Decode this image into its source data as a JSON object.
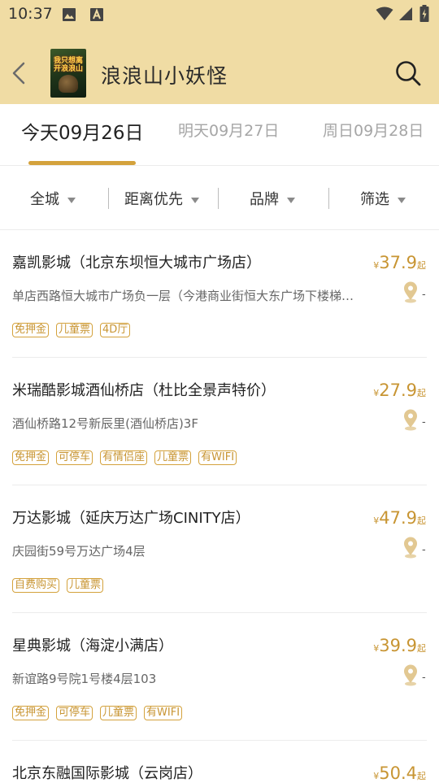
{
  "status_bar": {
    "time": "10:37"
  },
  "header": {
    "movie_title": "浪浪山小妖怪",
    "poster_text": "我只想离开浪浪山"
  },
  "date_tabs": [
    {
      "label": "今天09月26日",
      "active": true
    },
    {
      "label": "明天09月27日",
      "active": false
    },
    {
      "label": "周日09月28日",
      "active": false
    }
  ],
  "filters": [
    {
      "label": "全城"
    },
    {
      "label": "距离优先"
    },
    {
      "label": "品牌"
    },
    {
      "label": "筛选"
    }
  ],
  "cinemas": [
    {
      "name": "嘉凯影城（北京东坝恒大城市广场店）",
      "price_symbol": "¥",
      "price": "37.9",
      "price_suffix": "起",
      "address": "单店西路恒大城市广场负一层（今港商业街恒大东广场下楼梯…",
      "distance": "-",
      "tags": [
        "免押金",
        "儿童票",
        "4D厅"
      ]
    },
    {
      "name": "米瑞酷影城酒仙桥店（杜比全景声特价）",
      "price_symbol": "¥",
      "price": "27.9",
      "price_suffix": "起",
      "address": "酒仙桥路12号新辰里(酒仙桥店)3F",
      "distance": "-",
      "tags": [
        "免押金",
        "可停车",
        "有情侣座",
        "儿童票",
        "有WIFI"
      ]
    },
    {
      "name": "万达影城（延庆万达广场CINITY店）",
      "price_symbol": "¥",
      "price": "47.9",
      "price_suffix": "起",
      "address": "庆园街59号万达广场4层",
      "distance": "-",
      "tags": [
        "自费购买",
        "儿童票"
      ]
    },
    {
      "name": "星典影城（海淀小满店）",
      "price_symbol": "¥",
      "price": "39.9",
      "price_suffix": "起",
      "address": "新谊路9号院1号楼4层103",
      "distance": "-",
      "tags": [
        "免押金",
        "可停车",
        "儿童票",
        "有WIFI"
      ]
    },
    {
      "name": "北京东融国际影城（云岗店）",
      "price_symbol": "¥",
      "price": "50.4",
      "price_suffix": "起",
      "address": "",
      "distance": "",
      "tags": []
    }
  ],
  "colors": {
    "header_bg": "#f0dca4",
    "accent": "#d4a23c",
    "price": "#c89533"
  }
}
